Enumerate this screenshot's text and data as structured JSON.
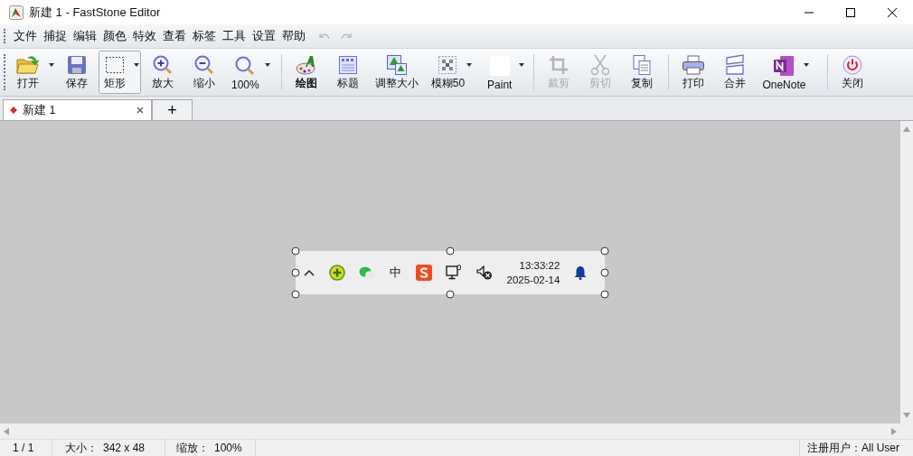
{
  "window": {
    "title": "新建 1 - FastStone Editor"
  },
  "menu": {
    "items": [
      "文件",
      "捕捉",
      "编辑",
      "颜色",
      "特效",
      "查看",
      "标签",
      "工具",
      "设置",
      "帮助"
    ],
    "undo_disabled": true,
    "redo_disabled": true
  },
  "toolbar": {
    "groups": [
      [
        {
          "label": "打开",
          "disabled": false,
          "dropdown": true,
          "selected": false,
          "bold": false
        },
        {
          "label": "保存",
          "disabled": false,
          "dropdown": false,
          "selected": false,
          "bold": false
        },
        {
          "label": "矩形",
          "disabled": false,
          "dropdown": true,
          "selected": true,
          "bold": false
        },
        {
          "label": "放大",
          "disabled": false,
          "dropdown": false,
          "selected": false,
          "bold": false
        },
        {
          "label": "缩小",
          "disabled": false,
          "dropdown": false,
          "selected": false,
          "bold": false
        },
        {
          "label": "100%",
          "disabled": false,
          "dropdown": true,
          "selected": false,
          "bold": false
        }
      ],
      [
        {
          "label": "绘图",
          "disabled": false,
          "dropdown": false,
          "selected": false,
          "bold": true
        },
        {
          "label": "标题",
          "disabled": false,
          "dropdown": false,
          "selected": false,
          "bold": false
        },
        {
          "label": "调整大小",
          "disabled": false,
          "dropdown": false,
          "selected": false,
          "bold": false
        },
        {
          "label": "模糊50",
          "disabled": false,
          "dropdown": true,
          "selected": false,
          "bold": false
        },
        {
          "label": "Paint",
          "disabled": false,
          "dropdown": true,
          "selected": false,
          "bold": false
        }
      ],
      [
        {
          "label": "裁剪",
          "disabled": true,
          "dropdown": false,
          "selected": false,
          "bold": false
        },
        {
          "label": "剪切",
          "disabled": true,
          "dropdown": false,
          "selected": false,
          "bold": false
        },
        {
          "label": "复制",
          "disabled": false,
          "dropdown": false,
          "selected": false,
          "bold": false
        }
      ],
      [
        {
          "label": "打印",
          "disabled": false,
          "dropdown": false,
          "selected": false,
          "bold": false
        },
        {
          "label": "合并",
          "disabled": false,
          "dropdown": false,
          "selected": false,
          "bold": false
        },
        {
          "label": "OneNote",
          "disabled": false,
          "dropdown": true,
          "selected": false,
          "bold": false
        }
      ],
      [
        {
          "label": "关闭",
          "disabled": false,
          "dropdown": false,
          "selected": false,
          "bold": false
        }
      ]
    ]
  },
  "tabs": [
    {
      "label": "新建 1",
      "kind": "document",
      "selected": true
    },
    {
      "label": "+",
      "kind": "add",
      "selected": false
    }
  ],
  "capture": {
    "ime_label": "中",
    "time": "13:33:22",
    "date": "2025-02-14"
  },
  "status_bar": {
    "page": "1 / 1",
    "size_label": "大小：",
    "size": "342 x 48",
    "zoom_label": "缩放：",
    "zoom": "100%",
    "user": "注册用户：All User"
  }
}
